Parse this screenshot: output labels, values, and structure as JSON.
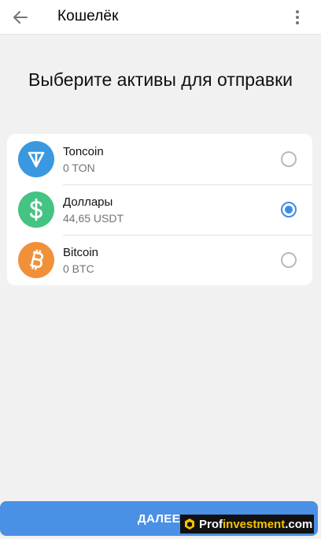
{
  "header": {
    "title": "Кошелёк",
    "back_icon": "arrow-left-icon",
    "menu_icon": "more-vertical-icon"
  },
  "page_title": "Выберите активы для отправки",
  "assets": [
    {
      "name": "Toncoin",
      "balance": "0 TON",
      "icon": "toncoin-icon",
      "color": "#3a98e0",
      "selected": false
    },
    {
      "name": "Доллары",
      "balance": "44,65 USDT",
      "icon": "dollar-icon",
      "color": "#44c383",
      "selected": true
    },
    {
      "name": "Bitcoin",
      "balance": "0 BTC",
      "icon": "bitcoin-icon",
      "color": "#f0913a",
      "selected": false
    }
  ],
  "next_button": {
    "label": "ДАЛЕЕ",
    "color": "#4a90e4"
  },
  "watermark": {
    "part1": "Prof",
    "part2": "investment",
    "part3": ".com"
  },
  "colors": {
    "accent": "#3d8de4",
    "background": "#f1f1f2"
  }
}
